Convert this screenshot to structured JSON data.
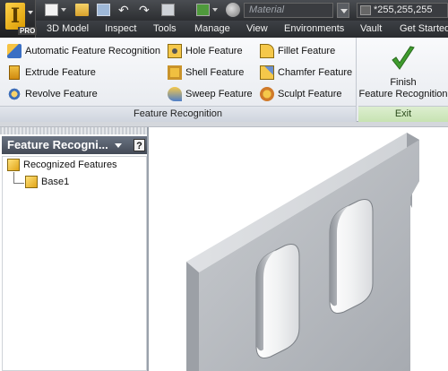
{
  "app": {
    "logo_letter": "I",
    "edition": "PRO"
  },
  "quick_access": {
    "material_placeholder": "Material",
    "color_value": "*255,255,255"
  },
  "tabs": [
    {
      "label": "3D Model"
    },
    {
      "label": "Inspect"
    },
    {
      "label": "Tools"
    },
    {
      "label": "Manage"
    },
    {
      "label": "View"
    },
    {
      "label": "Environments"
    },
    {
      "label": "Vault"
    },
    {
      "label": "Get Started"
    }
  ],
  "ribbon": {
    "feature_recognition": {
      "title": "Feature Recognition",
      "buttons": [
        {
          "label": "Automatic Feature Recognition",
          "icon": "auto-feature-recognition-icon"
        },
        {
          "label": "Extrude Feature",
          "icon": "extrude-icon"
        },
        {
          "label": "Revolve Feature",
          "icon": "revolve-icon"
        },
        {
          "label": "Hole Feature",
          "icon": "hole-icon"
        },
        {
          "label": "Shell Feature",
          "icon": "shell-icon"
        },
        {
          "label": "Sweep Feature",
          "icon": "sweep-icon"
        },
        {
          "label": "Fillet Feature",
          "icon": "fillet-icon"
        },
        {
          "label": "Chamfer Feature",
          "icon": "chamfer-icon"
        },
        {
          "label": "Sculpt Feature",
          "icon": "sculpt-icon"
        }
      ]
    },
    "exit": {
      "title": "Exit",
      "finish_line1": "Finish",
      "finish_line2": "Feature Recognition"
    }
  },
  "browser": {
    "title": "Feature Recogni...",
    "help": "?",
    "tree": [
      {
        "label": "Recognized Features"
      },
      {
        "label": "Base1"
      }
    ]
  },
  "colors": {
    "ribbon_bg": "#eef0f3",
    "exit_panel_accent": "#c7e3b2",
    "part_face": "#b9bcc1"
  }
}
